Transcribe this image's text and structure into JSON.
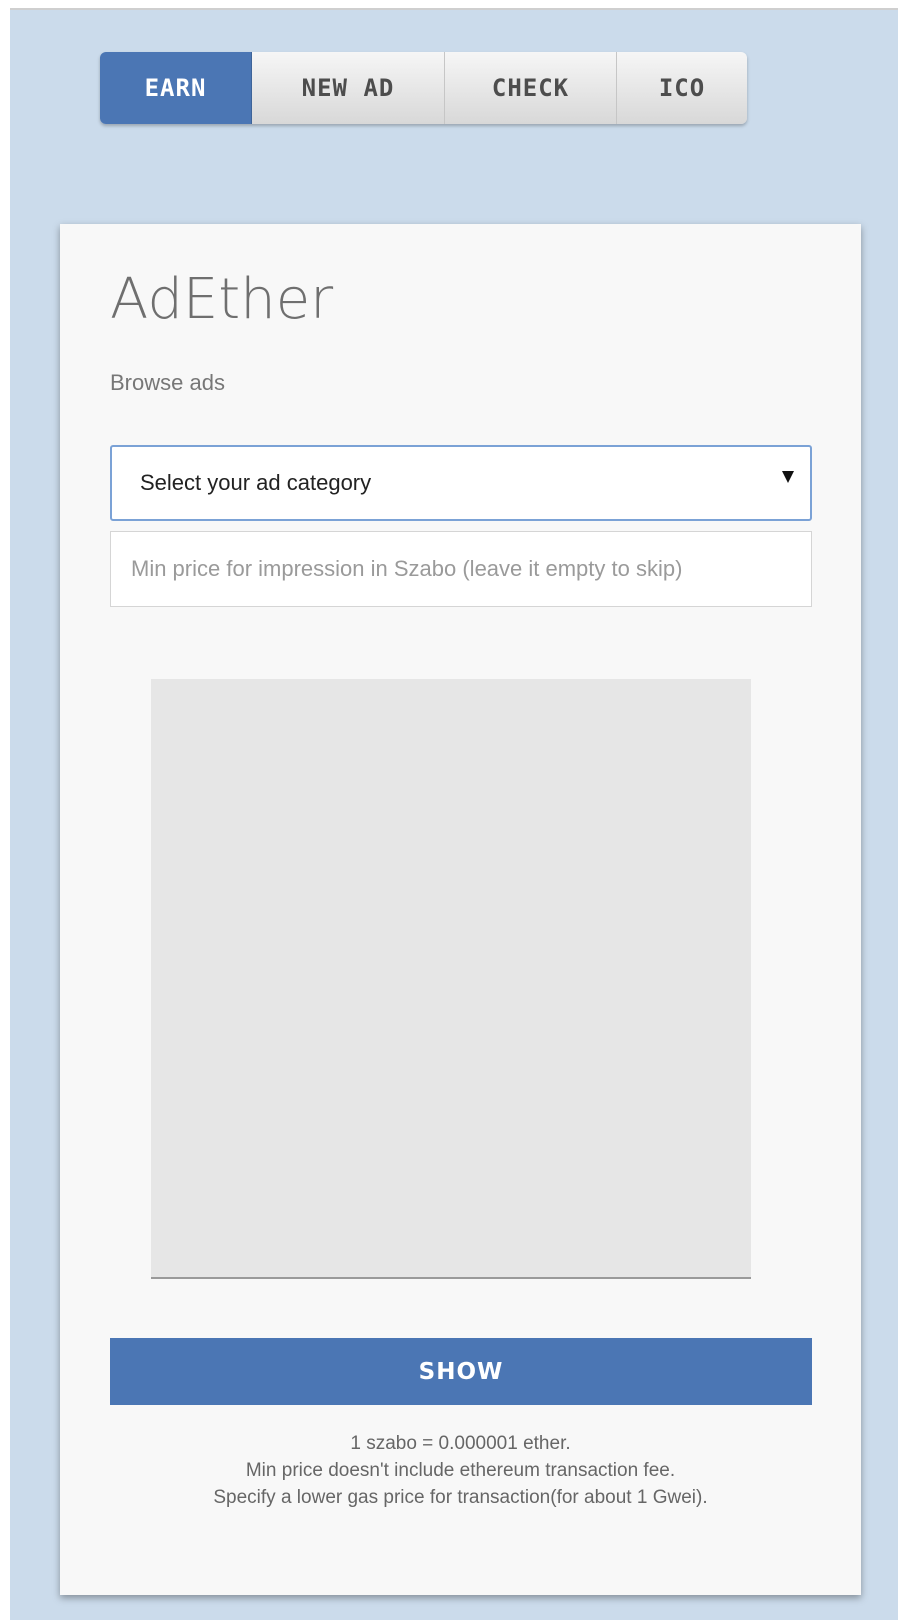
{
  "nav": {
    "tabs": [
      {
        "label": "EARN",
        "active": true
      },
      {
        "label": "NEW AD",
        "active": false
      },
      {
        "label": "CHECK",
        "active": false
      },
      {
        "label": "ICO",
        "active": false
      }
    ]
  },
  "card": {
    "title": "AdEther",
    "subtitle": "Browse ads",
    "category_select": {
      "selected": "Select your ad category"
    },
    "price_input": {
      "value": "",
      "placeholder": "Min price for impression in Szabo (leave it empty to skip)"
    },
    "show_button_label": "SHOW",
    "footnotes": [
      "1 szabo = 0.000001 ether.",
      "Min price doesn't include ethereum transaction fee.",
      "Specify a lower gas price for transaction(for about 1 Gwei)."
    ]
  },
  "colors": {
    "page_background": "#cbdbeb",
    "accent": "#4b76b4",
    "card_background": "#f8f8f8",
    "ad_placeholder": "#e6e6e6"
  }
}
